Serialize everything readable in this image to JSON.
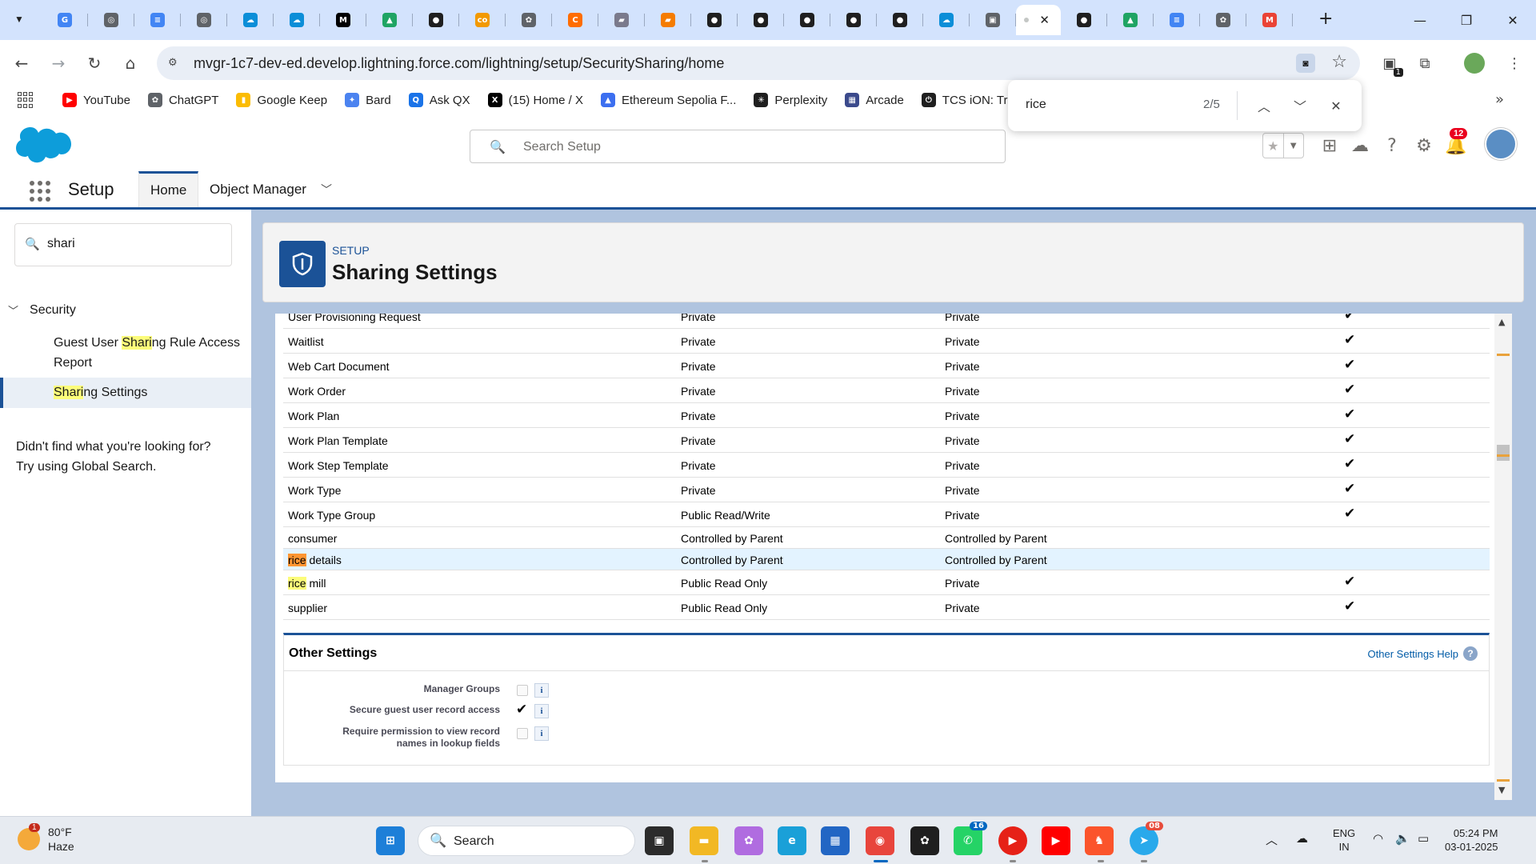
{
  "browser": {
    "tabs": [
      {
        "icon": "google-icon",
        "color": "#4285f4",
        "glyph": "G"
      },
      {
        "icon": "web-icon",
        "color": "#5f6368",
        "glyph": "◎"
      },
      {
        "icon": "docs-icon",
        "color": "#4285f4",
        "glyph": "≡"
      },
      {
        "icon": "web-icon",
        "color": "#5f6368",
        "glyph": "◎"
      },
      {
        "icon": "salesforce-icon",
        "color": "#0b8ed8",
        "glyph": "☁"
      },
      {
        "icon": "salesforce-icon",
        "color": "#0b8ed8",
        "glyph": "☁"
      },
      {
        "icon": "medium-icon",
        "color": "#000000",
        "glyph": "M"
      },
      {
        "icon": "drive-icon",
        "color": "#1fa463",
        "glyph": "▲"
      },
      {
        "icon": "github-icon",
        "color": "#1f1f1f",
        "glyph": "●"
      },
      {
        "icon": "coursera-icon",
        "color": "#f29900",
        "glyph": "co"
      },
      {
        "icon": "chatgpt-icon",
        "color": "#5f6368",
        "glyph": "✿"
      },
      {
        "icon": "loader-icon",
        "color": "#ff6d00",
        "glyph": "C"
      },
      {
        "icon": "book-icon",
        "color": "#7a7a8c",
        "glyph": "▰"
      },
      {
        "icon": "notes-icon",
        "color": "#f57c00",
        "glyph": "▰"
      },
      {
        "icon": "github-icon",
        "color": "#1f1f1f",
        "glyph": "●"
      },
      {
        "icon": "github-icon",
        "color": "#1f1f1f",
        "glyph": "●"
      },
      {
        "icon": "github-icon",
        "color": "#1f1f1f",
        "glyph": "●"
      },
      {
        "icon": "github-icon",
        "color": "#1f1f1f",
        "glyph": "●"
      },
      {
        "icon": "github-icon",
        "color": "#1f1f1f",
        "glyph": "●"
      },
      {
        "icon": "salesforce-icon",
        "color": "#0b8ed8",
        "glyph": "☁"
      },
      {
        "icon": "image-icon",
        "color": "#5f6368",
        "glyph": "▣"
      }
    ],
    "tabs_after": [
      {
        "icon": "github-icon",
        "color": "#1f1f1f",
        "glyph": "●"
      },
      {
        "icon": "drive-icon",
        "color": "#1fa463",
        "glyph": "▲"
      },
      {
        "icon": "docs-icon",
        "color": "#4285f4",
        "glyph": "≡"
      },
      {
        "icon": "chatgpt-icon",
        "color": "#5f6368",
        "glyph": "✿"
      },
      {
        "icon": "gmail-icon",
        "color": "#ea4335",
        "glyph": "M"
      }
    ],
    "url": "mvgr-1c7-dev-ed.develop.lightning.force.com/lightning/setup/SecuritySharing/home",
    "extensions_badge": "1",
    "bookmarks": [
      {
        "label": "YouTube",
        "icon": "youtube-icon",
        "color": "#ff0000",
        "glyph": "▶"
      },
      {
        "label": "ChatGPT",
        "icon": "chatgpt-icon",
        "color": "#5f6368",
        "glyph": "✿"
      },
      {
        "label": "Google Keep",
        "icon": "keep-icon",
        "color": "#fbbc04",
        "glyph": "▮"
      },
      {
        "label": "Bard",
        "icon": "bard-icon",
        "color": "#4b83f0",
        "glyph": "✦"
      },
      {
        "label": "Ask QX",
        "icon": "askqx-icon",
        "color": "#1a73e8",
        "glyph": "Q"
      },
      {
        "label": "(15) Home / X",
        "icon": "x-icon",
        "color": "#000000",
        "glyph": "X"
      },
      {
        "label": "Ethereum Sepolia F...",
        "icon": "ethereum-icon",
        "color": "#3c6ff0",
        "glyph": "▲"
      },
      {
        "label": "Perplexity",
        "icon": "perplexity-icon",
        "color": "#1f1f1f",
        "glyph": "✳"
      },
      {
        "label": "Arcade",
        "icon": "arcade-icon",
        "color": "#3b4a8c",
        "glyph": "▦"
      },
      {
        "label": "TCS iON: Trans",
        "icon": "power-icon",
        "color": "#1f1f1f",
        "glyph": "⏻"
      }
    ]
  },
  "findbar": {
    "query": "rice",
    "count": "2/5"
  },
  "salesforce": {
    "search_placeholder": "Search Setup",
    "notification_count": "12",
    "app_name": "Setup",
    "tabs": {
      "home": "Home",
      "object_manager": "Object Manager"
    },
    "quick_find_value": "shari",
    "tree": {
      "section": "Security",
      "item1_pre": "Guest User ",
      "item1_hl": "Shari",
      "item1_post": "ng Rule Access Report",
      "item2_hl": "Shari",
      "item2_post": "ng Settings"
    },
    "not_found_line1": "Didn't find what you're looking for?",
    "not_found_line2": "Try using Global Search."
  },
  "page": {
    "breadcrumb": "SETUP",
    "title": "Sharing Settings"
  },
  "objects": {
    "partial_row": {
      "name": "User Provisioning Request",
      "internal": "Private",
      "external": "Private",
      "checked": true
    },
    "rows": [
      {
        "name": "Waitlist",
        "internal": "Private",
        "external": "Private",
        "checked": true
      },
      {
        "name": "Web Cart Document",
        "internal": "Private",
        "external": "Private",
        "checked": true
      },
      {
        "name": "Work Order",
        "internal": "Private",
        "external": "Private",
        "checked": true
      },
      {
        "name": "Work Plan",
        "internal": "Private",
        "external": "Private",
        "checked": true
      },
      {
        "name": "Work Plan Template",
        "internal": "Private",
        "external": "Private",
        "checked": true
      },
      {
        "name": "Work Step Template",
        "internal": "Private",
        "external": "Private",
        "checked": true
      },
      {
        "name": "Work Type",
        "internal": "Private",
        "external": "Private",
        "checked": true
      },
      {
        "name": "Work Type Group",
        "internal": "Public Read/Write",
        "external": "Private",
        "checked": true
      },
      {
        "name": "consumer",
        "internal": "Controlled by Parent",
        "external": "Controlled by Parent",
        "checked": false
      },
      {
        "name_hl": "rice",
        "name_rest": " details",
        "internal": "Controlled by Parent",
        "external": "Controlled by Parent",
        "checked": false,
        "current": true
      },
      {
        "name_hl": "rice",
        "name_rest": " mill",
        "internal": "Public Read Only",
        "external": "Private",
        "checked": true
      },
      {
        "name": "supplier",
        "internal": "Public Read Only",
        "external": "Private",
        "checked": true
      }
    ]
  },
  "other_settings": {
    "title": "Other Settings",
    "help": "Other Settings Help",
    "items": [
      {
        "label": "Manager Groups",
        "checked": false
      },
      {
        "label": "Secure guest user record access",
        "checked": true
      },
      {
        "label_line1": "Require permission to view record",
        "label_line2": "names in lookup fields",
        "checked": false
      }
    ]
  },
  "taskbar": {
    "weather_temp": "80°F",
    "weather_desc": "Haze",
    "weather_badge": "1",
    "search_label": "Search",
    "whatsapp_badge": "16",
    "telegram_badge": "08",
    "lang_line1": "ENG",
    "lang_line2": "IN",
    "time": "05:24 PM",
    "date": "03-01-2025"
  }
}
